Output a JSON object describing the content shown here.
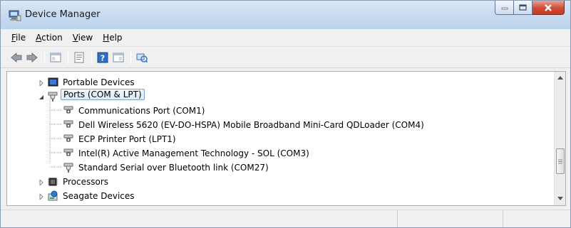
{
  "window": {
    "title": "Device Manager"
  },
  "menu": [
    {
      "label_rest": "ile",
      "accel": "F"
    },
    {
      "label_rest": "ction",
      "accel": "A"
    },
    {
      "label_rest": "iew",
      "accel": "V"
    },
    {
      "label_rest": "elp",
      "accel": "H"
    }
  ],
  "toolbar": {
    "buttons": [
      "back-icon",
      "forward-icon",
      "properties-icon",
      "update-driver-icon",
      "help-icon",
      "show-hidden-icon",
      "scan-hardware-icon"
    ]
  },
  "tree": {
    "nodes": [
      {
        "label": "Portable Devices",
        "state": "collapsed",
        "icon": "portable-device-icon"
      },
      {
        "label": "Ports (COM & LPT)",
        "state": "expanded",
        "icon": "port-icon",
        "selected": true
      },
      {
        "label": "Communications Port (COM1)",
        "icon": "port-icon"
      },
      {
        "label": "Dell Wireless 5620 (EV-DO-HSPA) Mobile Broadband Mini-Card QDLoader (COM4)",
        "icon": "port-icon"
      },
      {
        "label": "ECP Printer Port (LPT1)",
        "icon": "port-icon"
      },
      {
        "label": "Intel(R) Active Management Technology - SOL (COM3)",
        "icon": "port-icon"
      },
      {
        "label": "Standard Serial over Bluetooth link (COM27)",
        "icon": "port-icon"
      },
      {
        "label": "Processors",
        "state": "collapsed",
        "icon": "processor-icon"
      },
      {
        "label": "Seagate Devices",
        "state": "collapsed",
        "icon": "seagate-device-icon"
      }
    ]
  },
  "colors": {
    "selection_border": "#7da2ce",
    "close_button": "#c23a22"
  }
}
